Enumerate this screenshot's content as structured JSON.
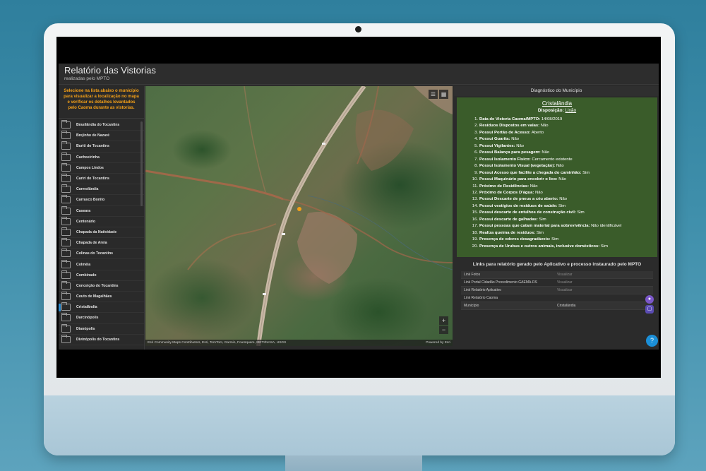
{
  "app": {
    "title": "Relatório das Vistorias",
    "subtitle": "realizadas pelo MPTO"
  },
  "sidebar": {
    "instructions": "Selecione na lista abaixo o município para visualizar a localização no mapa e verificar os detalhes levantados pelo Caoma durante as vistorias.",
    "items": [
      {
        "label": "Brasilândia do Tocantins",
        "selected": false
      },
      {
        "label": "Brejinho de Nazaré",
        "selected": false
      },
      {
        "label": "Buriti do Tocantins",
        "selected": false
      },
      {
        "label": "Cachoeirinha",
        "selected": false
      },
      {
        "label": "Campos Lindos",
        "selected": false
      },
      {
        "label": "Cariri do Tocantins",
        "selected": false
      },
      {
        "label": "Carmolândia",
        "selected": false
      },
      {
        "label": "Carrasco Bonito",
        "selected": false
      },
      {
        "label": "Caseara",
        "selected": false
      },
      {
        "label": "Centenário",
        "selected": false
      },
      {
        "label": "Chapada da Natividade",
        "selected": false
      },
      {
        "label": "Chapada de Areia",
        "selected": false
      },
      {
        "label": "Colinas do Tocantins",
        "selected": false
      },
      {
        "label": "Colméia",
        "selected": false
      },
      {
        "label": "Combinado",
        "selected": false
      },
      {
        "label": "Conceição do Tocantins",
        "selected": false
      },
      {
        "label": "Couto de Magalhães",
        "selected": false
      },
      {
        "label": "Cristalândia",
        "selected": true
      },
      {
        "label": "Darcinópolis",
        "selected": false
      },
      {
        "label": "Dianópolis",
        "selected": false
      },
      {
        "label": "Divinópolis do Tocantins",
        "selected": false
      }
    ]
  },
  "map": {
    "attribution": "Esri Community Maps Contributors, Esri, TomTom, Garmin, Foursquare, METI/NASA, USGS",
    "powered_by": "Powered by Esri",
    "zoom_in": "+",
    "zoom_out": "−"
  },
  "diagnostic": {
    "header": "Diagnóstico do Município",
    "city": "Cristalândia",
    "disposition_label": "Disposição:",
    "disposition_value": "Lixão",
    "items": [
      {
        "num": "1.",
        "label": "Data de Vistoria Caoma/MPTO:",
        "value": "14/08/2019"
      },
      {
        "num": "2.",
        "label": "Resíduos Dispostos em valas:",
        "value": "Não"
      },
      {
        "num": "3.",
        "label": "Possui Portão de Acesso:",
        "value": "Aberto"
      },
      {
        "num": "4.",
        "label": "Possui Guarita:",
        "value": "Não"
      },
      {
        "num": "5.",
        "label": "Possui Vigilantes:",
        "value": "Não"
      },
      {
        "num": "6.",
        "label": "Possui Balança para pesagem:",
        "value": "Não"
      },
      {
        "num": "7.",
        "label": "Possui Isolamento Físico:",
        "value": "Cercamento existente"
      },
      {
        "num": "8.",
        "label": "Possui Isolamento Visual (vegetação):",
        "value": "Não"
      },
      {
        "num": "9.",
        "label": "Possui Acesso que facilite a chegada do caminhão:",
        "value": "Sim"
      },
      {
        "num": "10.",
        "label": "Possui Maquinário para encobrir o lixo:",
        "value": "Não"
      },
      {
        "num": "11.",
        "label": "Próximo de Residências:",
        "value": "Não"
      },
      {
        "num": "12.",
        "label": "Próximo de Corpos D'água:",
        "value": "Não"
      },
      {
        "num": "13.",
        "label": "Possui Descarte de pneus a céu aberto:",
        "value": "Não"
      },
      {
        "num": "14.",
        "label": "Possui vestígios de resíduos de saúde:",
        "value": "Sim"
      },
      {
        "num": "15.",
        "label": "Possui descarte de entulhos de construção civil:",
        "value": "Sim"
      },
      {
        "num": "16.",
        "label": "Possui descarte de galhadas:",
        "value": "Sim"
      },
      {
        "num": "17.",
        "label": "Possui pessoas que catam material para sobrevivência:",
        "value": "Não identificável"
      },
      {
        "num": "18.",
        "label": "Realiza queima de resíduos:",
        "value": "Sim"
      },
      {
        "num": "19.",
        "label": "Presença de odores desagradáveis:",
        "value": "Sim"
      },
      {
        "num": "20.",
        "label": "Presença de Urubus e outros animais, inclusive domésticos:",
        "value": "Sim"
      }
    ]
  },
  "links": {
    "header": "Links para relatório gerado pelo Aplicativo e processo instaurado pelo MPTO",
    "rows": [
      {
        "key": "Link Fotos",
        "value": "Visualizar",
        "is_link": true
      },
      {
        "key": "Link Portal Cidadão Procedimento GAEMA-RS",
        "value": "Visualizar",
        "is_link": true
      },
      {
        "key": "Link Relatório Aplicativo",
        "value": "Visualizar",
        "is_link": true
      },
      {
        "key": "Link Relatório Caoma",
        "value": "",
        "is_link": true
      },
      {
        "key": "Município",
        "value": "Cristalândia",
        "is_link": false
      }
    ]
  },
  "colors": {
    "accent": "#f4a017",
    "diagnostic_bg": "#3a5c2a",
    "selection": "#2d8fd5",
    "help_button": "#1b8fd7"
  }
}
